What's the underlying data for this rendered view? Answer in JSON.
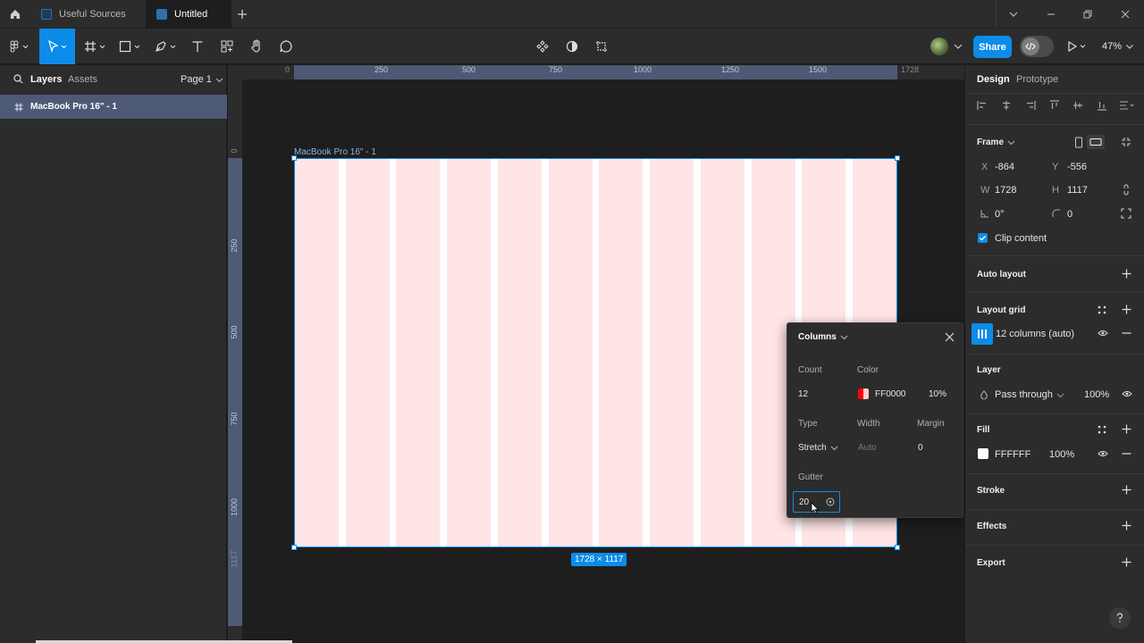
{
  "tabs": [
    {
      "label": "Useful Sources",
      "active": false
    },
    {
      "label": "Untitled",
      "active": true
    }
  ],
  "toolbar": {
    "share_label": "Share",
    "zoom": "47%"
  },
  "left_panel": {
    "tabs": [
      "Layers",
      "Assets"
    ],
    "page": "Page 1",
    "layers": [
      {
        "name": "MacBook Pro 16\" - 1"
      }
    ]
  },
  "rulers": {
    "top": [
      "0",
      "250",
      "500",
      "750",
      "1000",
      "1250",
      "1500",
      "1728"
    ],
    "left": [
      "0",
      "250",
      "500",
      "750",
      "1000",
      "1117"
    ]
  },
  "canvas": {
    "frame_name": "MacBook Pro 16\" - 1",
    "size_badge": "1728 × 1117"
  },
  "grid_popover": {
    "title": "Columns",
    "count_label": "Count",
    "count": "12",
    "color_label": "Color",
    "color_hex": "FF0000",
    "color_swatch": "#ff0000",
    "opacity": "10%",
    "type_label": "Type",
    "type": "Stretch",
    "width_label": "Width",
    "width": "Auto",
    "margin_label": "Margin",
    "margin": "0",
    "gutter_label": "Gutter",
    "gutter": "20"
  },
  "right_panel": {
    "tabs": [
      "Design",
      "Prototype"
    ],
    "frame": {
      "title": "Frame",
      "x_label": "X",
      "x": "-864",
      "y_label": "Y",
      "y": "-556",
      "w_label": "W",
      "w": "1728",
      "h_label": "H",
      "h": "1117",
      "rotation": "0°",
      "radius": "0",
      "clip_label": "Clip content",
      "clip_checked": true
    },
    "auto_layout": "Auto layout",
    "layout_grid": {
      "title": "Layout grid",
      "item": "12 columns (auto)"
    },
    "layer": {
      "title": "Layer",
      "blend": "Pass through",
      "opacity": "100%"
    },
    "fill": {
      "title": "Fill",
      "hex": "FFFFFF",
      "opacity": "100%",
      "swatch": "#ffffff"
    },
    "stroke": "Stroke",
    "effects": "Effects",
    "export": "Export"
  },
  "colors": {
    "accent": "#0c8ce9",
    "grid_column": "#ffe5e5"
  }
}
